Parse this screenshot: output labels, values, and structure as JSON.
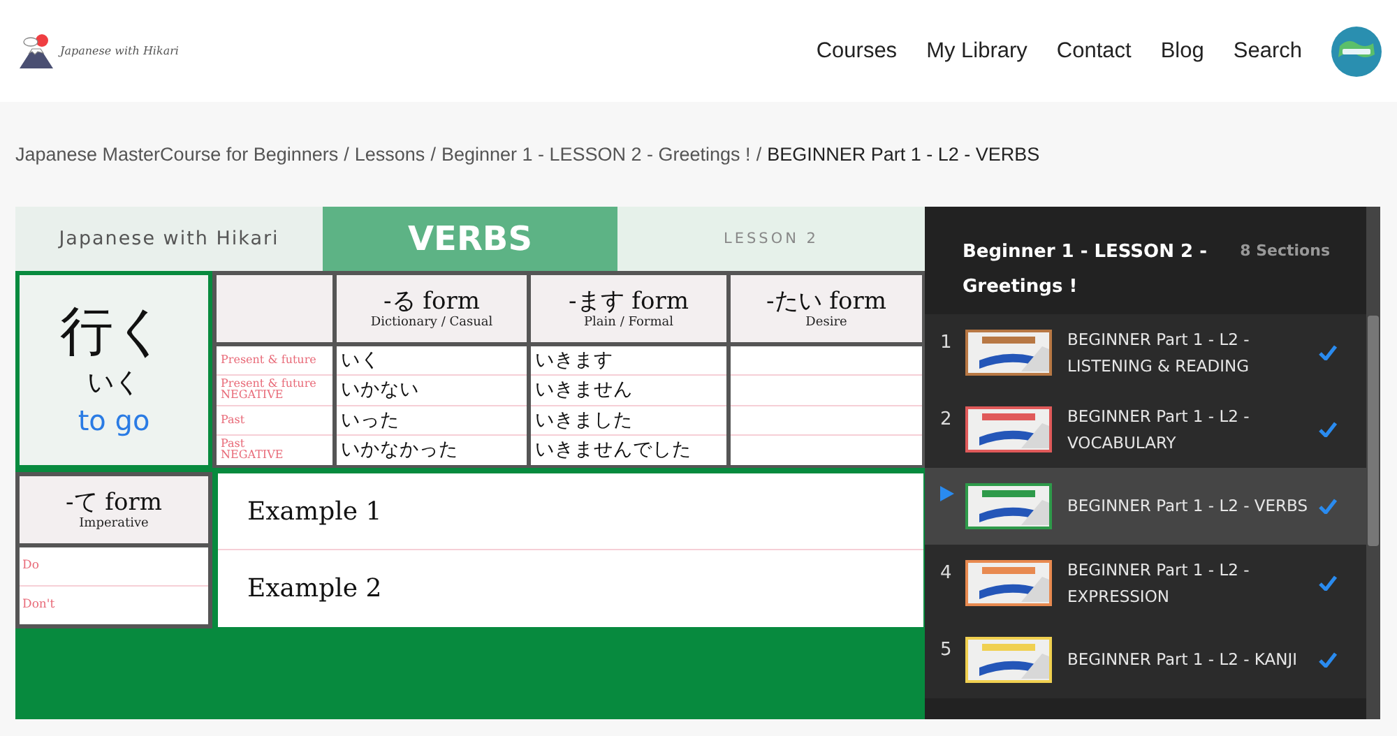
{
  "header": {
    "logo_text": "Japanese with Hikari",
    "nav": [
      "Courses",
      "My Library",
      "Contact",
      "Blog",
      "Search"
    ]
  },
  "breadcrumb": {
    "items": [
      "Japanese MasterCourse for Beginners",
      "Lessons",
      "Beginner 1 - LESSON 2 - Greetings !",
      "BEGINNER Part 1 - L2 - VERBS"
    ],
    "separators": [
      "/",
      "/",
      "/"
    ]
  },
  "slide": {
    "brand": "Japanese with Hikari",
    "title": "VERBS",
    "lesson": "LESSON 2",
    "verb": {
      "kanji": "行く",
      "kana": "いく",
      "meaning": "to go"
    },
    "row_labels": [
      "Present & future",
      "Present & future\nNEGATIVE",
      "Past",
      "Past\nNEGATIVE"
    ],
    "forms": [
      {
        "name": "-る form",
        "subtitle": "Dictionary / Casual",
        "values": [
          "いく",
          "いかない",
          "いった",
          "いかなかった"
        ]
      },
      {
        "name": "-ます form",
        "subtitle": "Plain / Formal",
        "values": [
          "いきます",
          "いきません",
          "いきました",
          "いきませんでした"
        ]
      },
      {
        "name": "-たい form",
        "subtitle": "Desire"
      }
    ],
    "te_form": {
      "name": "-て form",
      "subtitle": "Imperative",
      "labels": [
        "Do",
        "Don't"
      ]
    },
    "examples": [
      "Example 1",
      "Example 2"
    ]
  },
  "sidebar": {
    "title": "Beginner 1 - LESSON 2 - Greetings !",
    "count": "8 Sections",
    "items": [
      {
        "number": "1",
        "title": "BEGINNER Part 1 - L2 - LISTENING & READING",
        "selected": false,
        "completed": true,
        "color": "#b87844"
      },
      {
        "number": "2",
        "title": "BEGINNER Part 1 - L2 - VOCABULARY",
        "selected": false,
        "completed": true,
        "color": "#e05a5a"
      },
      {
        "title": "BEGINNER Part 1 - L2 - VERBS",
        "selected": true,
        "completed": true,
        "color": "#2e9a4a"
      },
      {
        "number": "4",
        "title": "BEGINNER Part 1 - L2 - EXPRESSION",
        "selected": false,
        "completed": true,
        "color": "#e88a50"
      },
      {
        "number": "5",
        "title": "BEGINNER Part 1 - L2 - KANJI",
        "selected": false,
        "completed": true,
        "color": "#f0d050"
      }
    ]
  }
}
